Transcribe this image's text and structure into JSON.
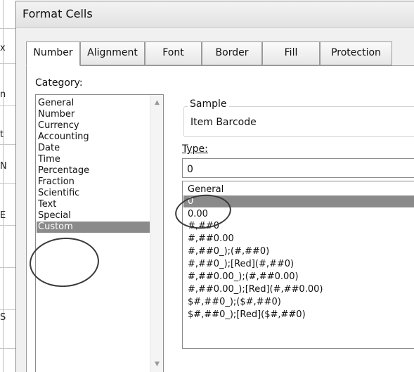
{
  "dialog": {
    "title": "Format Cells"
  },
  "tabs": [
    {
      "label": "Number",
      "active": true
    },
    {
      "label": "Alignment",
      "active": false
    },
    {
      "label": "Font",
      "active": false
    },
    {
      "label": "Border",
      "active": false
    },
    {
      "label": "Fill",
      "active": false
    },
    {
      "label": "Protection",
      "active": false
    }
  ],
  "category": {
    "label": "Category:",
    "items": [
      "General",
      "Number",
      "Currency",
      "Accounting",
      "Date",
      "Time",
      "Percentage",
      "Fraction",
      "Scientific",
      "Text",
      "Special",
      "Custom"
    ],
    "selected": "Custom",
    "scroll_up_icon": "scroll-up-arrow-icon",
    "scroll_down_icon": "scroll-down-arrow-icon"
  },
  "sample": {
    "label": "Sample",
    "value": "Item Barcode"
  },
  "type": {
    "label": "Type:",
    "value": "0"
  },
  "formats": {
    "items": [
      "General",
      "0",
      "0.00",
      "#,##0",
      "#,##0.00",
      "#,##0_);(#,##0)",
      "#,##0_);[Red](#,##0)",
      "#,##0.00_);(#,##0.00)",
      "#,##0.00_);[Red](#,##0.00)",
      "$#,##0_);($#,##0)",
      "$#,##0_);[Red]($#,##0)"
    ],
    "selected": "0"
  },
  "background_sheet": {
    "row_letters": [
      "x",
      "n",
      "t",
      "N",
      "E",
      "S"
    ]
  },
  "colors": {
    "selection": "#8a8a8a",
    "dialog_bg": "#f0f0f0",
    "annotation": "#3a3a3a"
  }
}
